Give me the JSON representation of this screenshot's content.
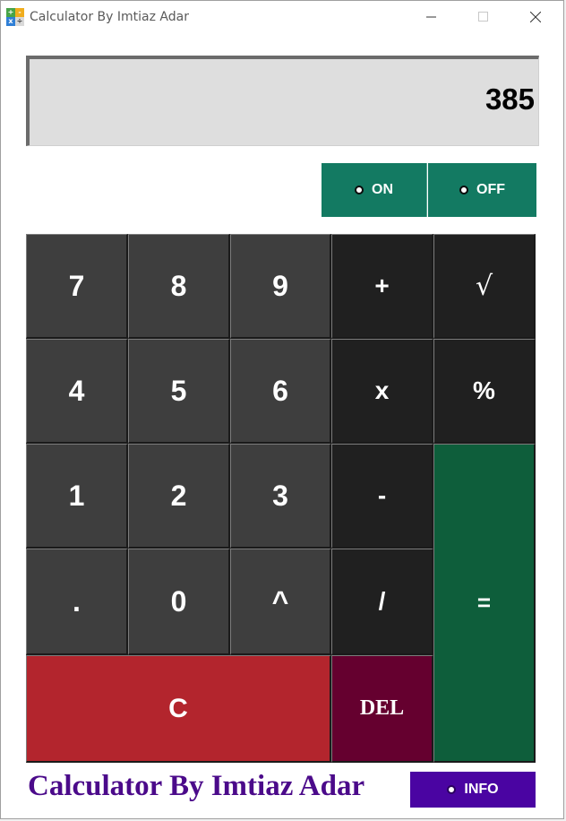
{
  "window": {
    "title": "Calculator By Imtiaz Adar",
    "app_icon_glyphs": [
      "+",
      "-",
      "x",
      "÷"
    ],
    "app_icon_colors": [
      "#47a447",
      "#f0ad1e",
      "#2f7fd6",
      "#d9d9d9"
    ]
  },
  "display": {
    "value": "385"
  },
  "power": {
    "on_label": "ON",
    "off_label": "OFF"
  },
  "keypad": {
    "k7": "7",
    "k8": "8",
    "k9": "9",
    "plus": "+",
    "sqrt": "√",
    "k4": "4",
    "k5": "5",
    "k6": "6",
    "multiply": "x",
    "percent": "%",
    "k1": "1",
    "k2": "2",
    "k3": "3",
    "minus": "-",
    "equals": "=",
    "dot": ".",
    "k0": "0",
    "power": "^",
    "divide": "/",
    "clear": "C",
    "delete": "DEL"
  },
  "footer": {
    "title": "Calculator By Imtiaz Adar",
    "info_label": "INFO"
  },
  "colors": {
    "accent_green": "#137a62",
    "equals_green": "#0e5e3b",
    "clear_red": "#b3252d",
    "delete_maroon": "#65002f",
    "info_purple": "#4a04a2",
    "footer_title_purple": "#4b0a8a",
    "number_key": "#3e3e3e",
    "operator_key": "#202020"
  }
}
